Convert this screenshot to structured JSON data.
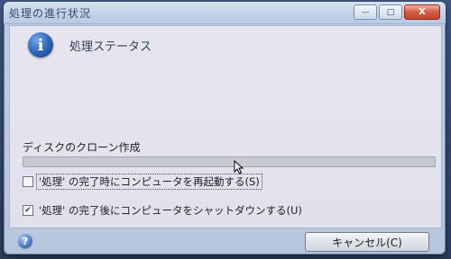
{
  "window": {
    "title": "処理の進行状況"
  },
  "title_controls": {
    "minimize": "—",
    "maximize": "□",
    "close": "X"
  },
  "header": {
    "icon": "info-icon",
    "icon_glyph": "i",
    "title": "処理ステータス"
  },
  "operation": {
    "label": "ディスクのクローン作成",
    "progress_percent": 0
  },
  "options": {
    "restart_label": "'処理' の完了時にコンピュータを再起動する(S)",
    "restart_checked": false,
    "shutdown_label": "'処理' の完了後にコンピュータをシャットダウンする(U)",
    "shutdown_checked": true
  },
  "footer": {
    "help_icon": "help-icon",
    "help_glyph": "?",
    "cancel_label": "キャンセル(C)"
  },
  "colors": {
    "titlebar": "#c3d2e8",
    "content_bg": "#e3e2ed",
    "info_icon": "#2a62b5",
    "close_button": "#d35b44"
  }
}
